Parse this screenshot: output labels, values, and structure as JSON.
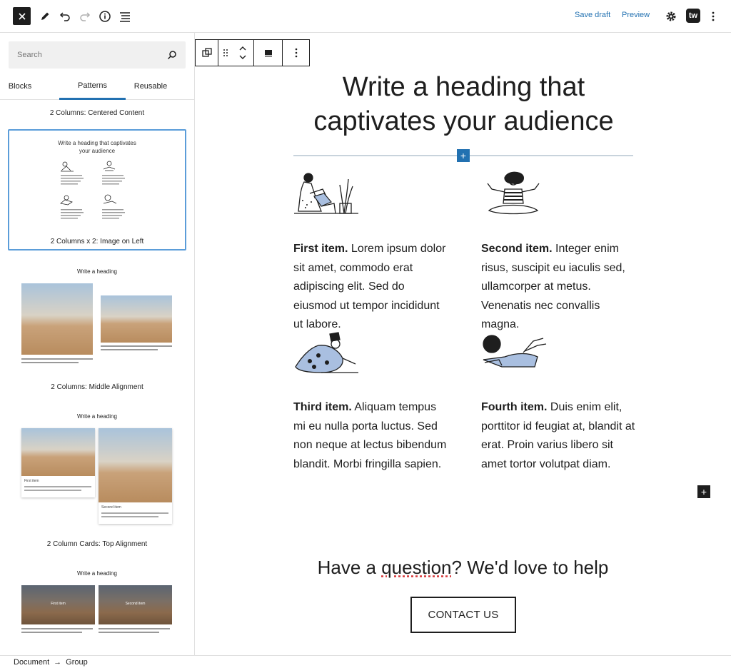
{
  "topbar": {
    "save_draft": "Save draft",
    "preview": "Preview",
    "badge": "tw",
    "icons": [
      "close-icon",
      "pencil-icon",
      "undo-icon",
      "redo-icon",
      "info-icon",
      "list-view-icon",
      "gear-icon",
      "more-vertical-icon"
    ]
  },
  "sidebar": {
    "search_placeholder": "Search",
    "tabs": [
      {
        "label": "Blocks",
        "active": false
      },
      {
        "label": "Patterns",
        "active": true
      },
      {
        "label": "Reusable",
        "active": false
      }
    ],
    "patterns": [
      {
        "title": "2 Columns: Centered Content"
      },
      {
        "title": "2 Columns x 2: Image on Left",
        "selected": true
      },
      {
        "title": "2 Columns: Middle Alignment"
      },
      {
        "title": "2 Column Cards: Top Alignment"
      }
    ],
    "preview_heading_small": "Write a heading that captivates your audience",
    "preview_heading": "Write a heading",
    "preview_first_item": "First item",
    "preview_second_item": "Second item"
  },
  "canvas": {
    "heading": "Write a heading that captivates your audience",
    "items": [
      {
        "title": "First item.",
        "body": " Lorem ipsum dolor sit amet, commodo erat adipiscing elit. Sed do eiusmod ut tempor incididunt ut labore."
      },
      {
        "title": "Second item.",
        "body": " Integer enim risus, suscipit eu iaculis sed, ullamcorper at metus. Venenatis nec convallis magna."
      },
      {
        "title": "Third item.",
        "body": " Aliquam tempus mi eu nulla porta luctus. Sed non neque at lectus bibendum blandit. Morbi fringilla sapien."
      },
      {
        "title": "Fourth item.",
        "body": " Duis enim elit, porttitor id feugiat at, blandit at erat. Proin varius libero sit amet tortor volutpat diam."
      }
    ],
    "question_parts": [
      "Have a ",
      "question",
      "? We'd love to help"
    ],
    "contact_button": "CONTACT US"
  },
  "footer": {
    "breadcrumb": [
      "Document",
      "Group"
    ]
  },
  "colors": {
    "accent": "#2271b1",
    "dark": "#1e1e1e"
  }
}
